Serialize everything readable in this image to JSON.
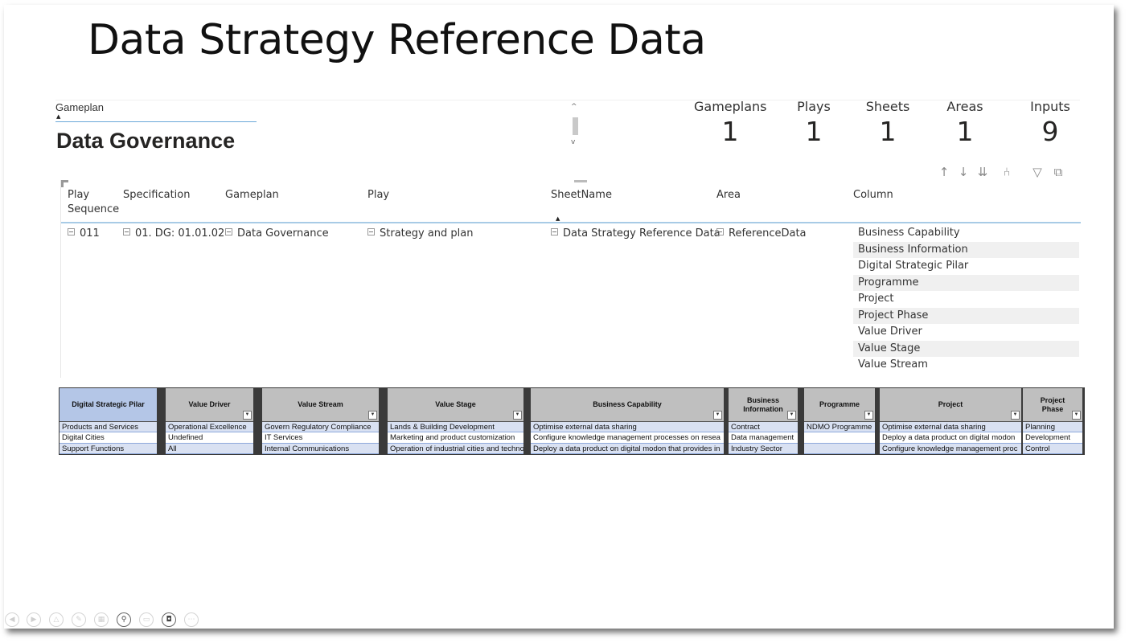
{
  "slide": {
    "title": "Data Strategy Reference Data"
  },
  "slicer": {
    "label": "Gameplan",
    "value": "Data Governance"
  },
  "kpis": [
    {
      "label": "Gameplans",
      "value": "1"
    },
    {
      "label": "Plays",
      "value": "1"
    },
    {
      "label": "Sheets",
      "value": "1"
    },
    {
      "label": "Areas",
      "value": "1"
    },
    {
      "label": "Inputs",
      "value": "9"
    }
  ],
  "visual_icons": [
    "sort-up-icon",
    "sort-down-icon",
    "drill-down-icon",
    "expand-hierarchy-icon",
    "filter-icon",
    "focus-mode-icon"
  ],
  "table": {
    "headers": {
      "play_sequence_1": "Play",
      "play_sequence_2": "Sequence",
      "specification": "Specification",
      "gameplan": "Gameplan",
      "play": "Play",
      "sheetname": "SheetName",
      "area": "Area",
      "column": "Column"
    },
    "row": {
      "play_sequence": "011",
      "specification": "01. DG: 01.01.02",
      "gameplan": "Data Governance",
      "play": "Strategy and plan",
      "sheetname": "Data Strategy Reference Data",
      "area": "ReferenceData"
    },
    "columns": [
      "Business Capability",
      "Business Information",
      "Digital Strategic Pilar",
      "Programme",
      "Project",
      "Project Phase",
      "Value Driver",
      "Value Stage",
      "Value Stream"
    ]
  },
  "excel": {
    "columns": [
      {
        "header": "Digital Strategic Pilar",
        "cells": [
          "Products and Services",
          "Digital Cities",
          "Support Functions"
        ]
      },
      {
        "header": "Value Driver",
        "cells": [
          "Operational Excellence",
          "Undefined",
          "All"
        ]
      },
      {
        "header": "Value Stream",
        "cells": [
          "Govern Regulatory Compliance",
          "IT Services",
          "Internal Communications"
        ]
      },
      {
        "header": "Value Stage",
        "cells": [
          "Lands & Building Development",
          "Marketing and product customization",
          "Operation of industrial cities and techno"
        ]
      },
      {
        "header": "Business Capability",
        "cells": [
          "Optimise external data sharing",
          "Configure knowledge management processes  on resea",
          "Deploy a data product on digital modon that provides in"
        ]
      },
      {
        "header": "Business Information",
        "cells": [
          "Contract",
          "Data management",
          "Industry Sector"
        ]
      },
      {
        "header": "Programme",
        "cells": [
          "NDMO Programme",
          "",
          ""
        ]
      },
      {
        "header": "Project",
        "cells": [
          "Optimise external data sharing",
          "Deploy a data product on digital modon",
          "Configure knowledge management proc"
        ]
      },
      {
        "header": "Project Phase",
        "cells": [
          "Planning",
          "Development",
          "Control"
        ]
      }
    ]
  },
  "presenter_bar": [
    "previous-icon",
    "next-icon",
    "pointer-icon",
    "pen-icon",
    "slides-icon",
    "zoom-icon",
    "subtitles-icon",
    "camera-icon",
    "more-icon"
  ]
}
